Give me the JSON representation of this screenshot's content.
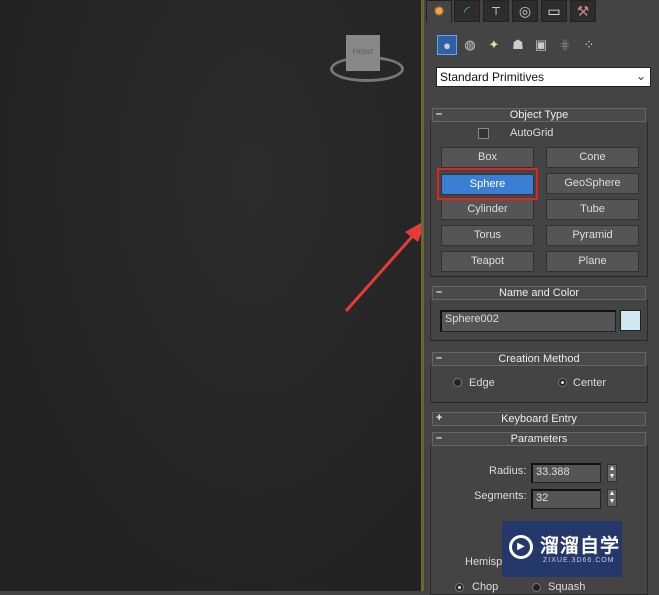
{
  "viewport": {
    "viewcube_label": "FRONT"
  },
  "command_panel": {
    "tabs": [
      "create-icon",
      "modify-icon",
      "hierarchy-icon",
      "motion-icon",
      "display-icon",
      "utilities-icon"
    ],
    "category_icons": [
      "geometry-icon",
      "shapes-icon",
      "lights-icon",
      "cameras-icon",
      "helpers-icon",
      "space-warps-icon",
      "systems-icon"
    ],
    "dropdown": {
      "selected": "Standard Primitives"
    },
    "object_type": {
      "title": "Object Type",
      "autogrid": "AutoGrid",
      "buttons": [
        "Box",
        "Cone",
        "Sphere",
        "GeoSphere",
        "Cylinder",
        "Tube",
        "Torus",
        "Pyramid",
        "Teapot",
        "Plane"
      ],
      "selected": "Sphere"
    },
    "name_color": {
      "title": "Name and Color",
      "name": "Sphere002",
      "color": "#cfe9f0"
    },
    "creation_method": {
      "title": "Creation Method",
      "options": [
        "Edge",
        "Center"
      ],
      "selected": "Center"
    },
    "keyboard_entry": {
      "title": "Keyboard Entry"
    },
    "parameters": {
      "title": "Parameters",
      "radius_label": "Radius:",
      "radius": "33.388",
      "segments_label": "Segments:",
      "segments": "32",
      "hemisphere_label": "Hemisphere:",
      "chop": "Chop",
      "squash": "Squash"
    }
  },
  "watermark": {
    "text": "溜溜自学",
    "url": "ZIXUE.3D66.COM"
  },
  "annotation": {
    "arrow_color": "#e83a3a",
    "highlight_color": "#e02424"
  }
}
